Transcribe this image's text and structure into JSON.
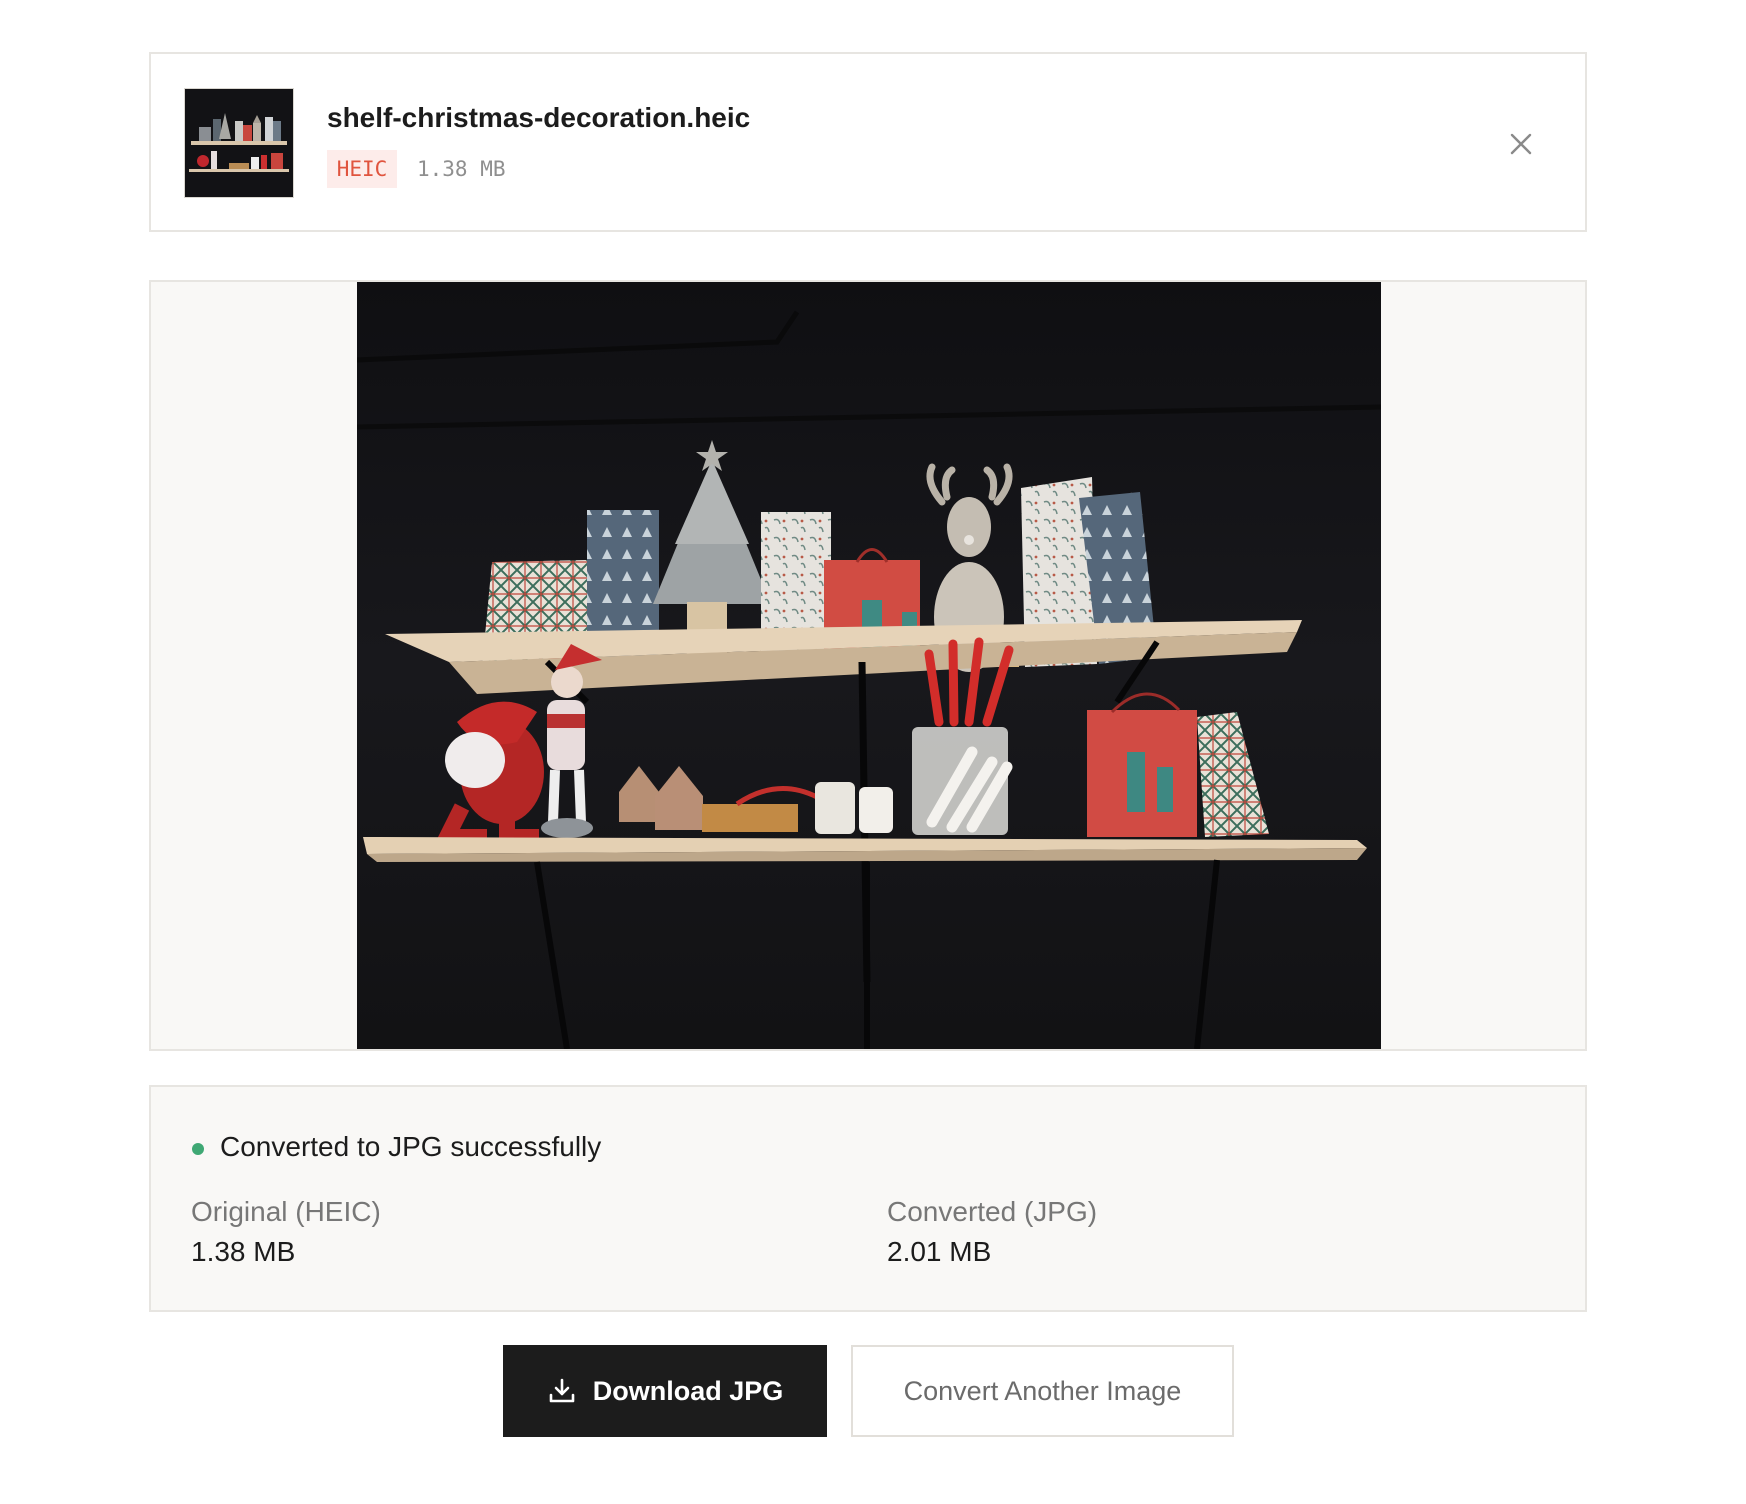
{
  "file": {
    "name": "shelf-christmas-decoration.heic",
    "format_badge": "HEIC",
    "size": "1.38 MB",
    "thumbnail": "shelf-christmas-decoration-thumbnail",
    "close_icon": "close-icon"
  },
  "preview": {
    "image": "shelf-christmas-decoration-preview"
  },
  "status": {
    "message": "Converted to JPG successfully",
    "dot_color": "#3fa874",
    "original_label": "Original (HEIC)",
    "original_value": "1.38 MB",
    "converted_label": "Converted (JPG)",
    "converted_value": "2.01 MB"
  },
  "actions": {
    "download_label": "Download JPG",
    "download_icon": "download-icon",
    "convert_another_label": "Convert Another Image"
  }
}
